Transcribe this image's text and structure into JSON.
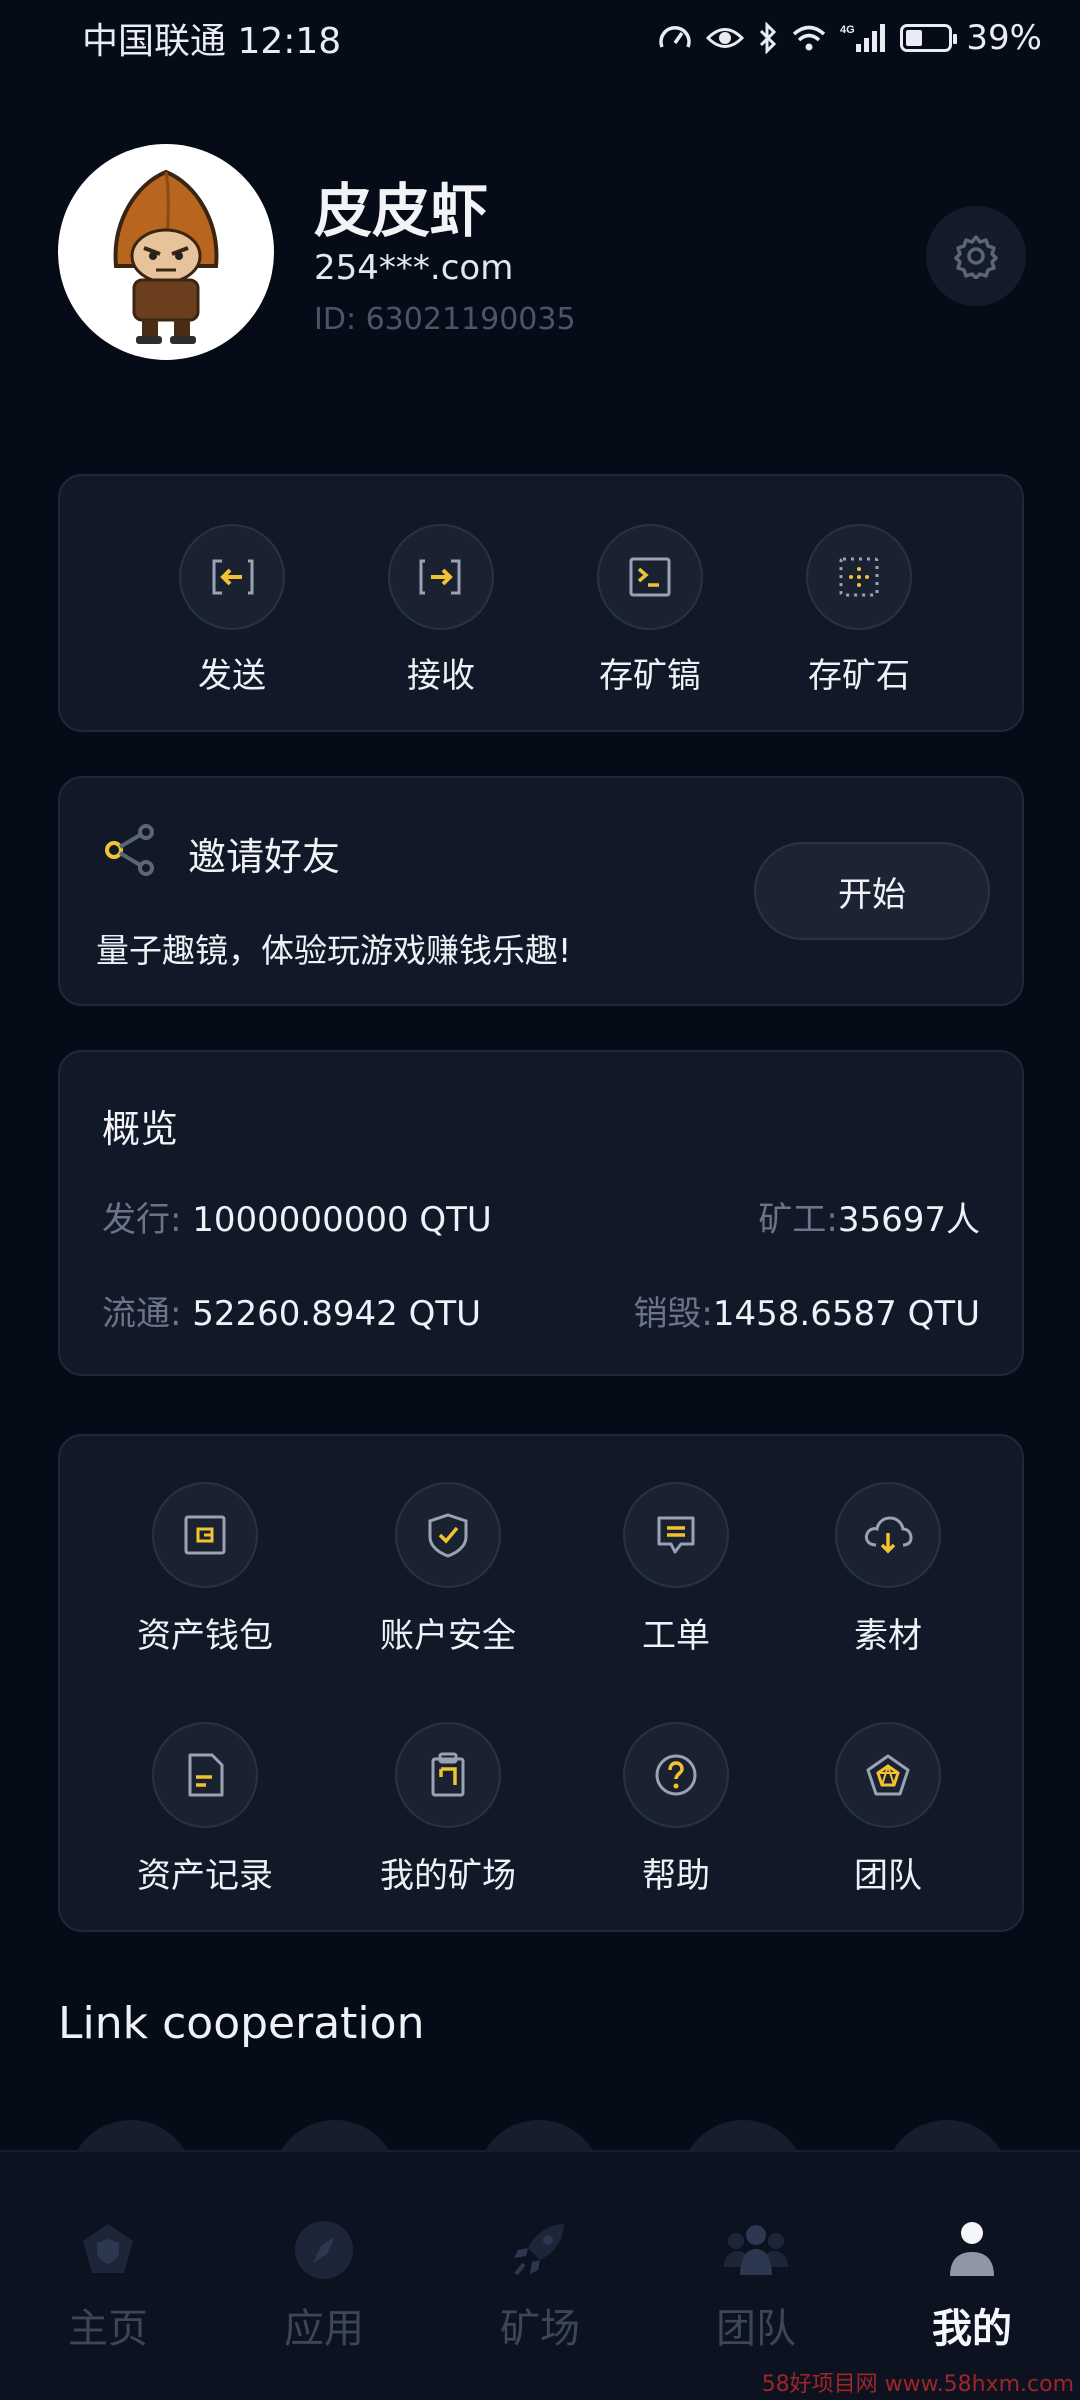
{
  "status_bar": {
    "carrier_time": "中国联通 12:18",
    "network": "4G",
    "battery": "39%",
    "battery_level": 0.39,
    "icons": [
      "speedometer-icon",
      "eye-icon",
      "bluetooth-icon",
      "wifi-icon",
      "signal-icon",
      "battery-icon"
    ]
  },
  "profile": {
    "name": "皮皮虾",
    "email": "254***.com",
    "id": "ID: 63021190035",
    "settings_icon": "gear-icon"
  },
  "quick_actions": [
    {
      "label": "发送",
      "icon": "send-icon"
    },
    {
      "label": "接收",
      "icon": "receive-icon"
    },
    {
      "label": "存矿镐",
      "icon": "terminal-icon"
    },
    {
      "label": "存矿石",
      "icon": "dotted-box-icon"
    }
  ],
  "invite": {
    "title": "邀请好友",
    "description": "量子趣镜，体验玩游戏赚钱乐趣!",
    "button": "开始",
    "icon": "share-icon"
  },
  "overview": {
    "title": "概览",
    "issued_label": "发行:",
    "issued_value": " 1000000000 QTU",
    "miners_label": "矿工:",
    "miners_value": "35697人",
    "circulation_label": "流通:",
    "circulation_value": " 52260.8942 QTU",
    "burned_label": "销毁:",
    "burned_value": "1458.6587 QTU"
  },
  "menu": [
    {
      "label": "资产钱包",
      "icon": "wallet-icon"
    },
    {
      "label": "账户安全",
      "icon": "shield-check-icon"
    },
    {
      "label": "工单",
      "icon": "message-icon"
    },
    {
      "label": "素材",
      "icon": "cloud-download-icon"
    },
    {
      "label": "资产记录",
      "icon": "document-icon"
    },
    {
      "label": "我的矿场",
      "icon": "clipboard-icon"
    },
    {
      "label": "帮助",
      "icon": "question-icon"
    },
    {
      "label": "团队",
      "icon": "pentagon-icon"
    }
  ],
  "link_section": {
    "title": "Link cooperation"
  },
  "bottom_nav": [
    {
      "label": "主页",
      "icon": "home-shield-icon",
      "active": false
    },
    {
      "label": "应用",
      "icon": "compass-icon",
      "active": false
    },
    {
      "label": "矿场",
      "icon": "rocket-icon",
      "active": false
    },
    {
      "label": "团队",
      "icon": "team-icon",
      "active": false
    },
    {
      "label": "我的",
      "icon": "user-icon",
      "active": true
    }
  ],
  "watermark": "58好项目网 www.58hxm.com",
  "colors": {
    "background": "#050b17",
    "card": "#111827",
    "accent": "#f2c230",
    "muted": "#6c7587"
  }
}
